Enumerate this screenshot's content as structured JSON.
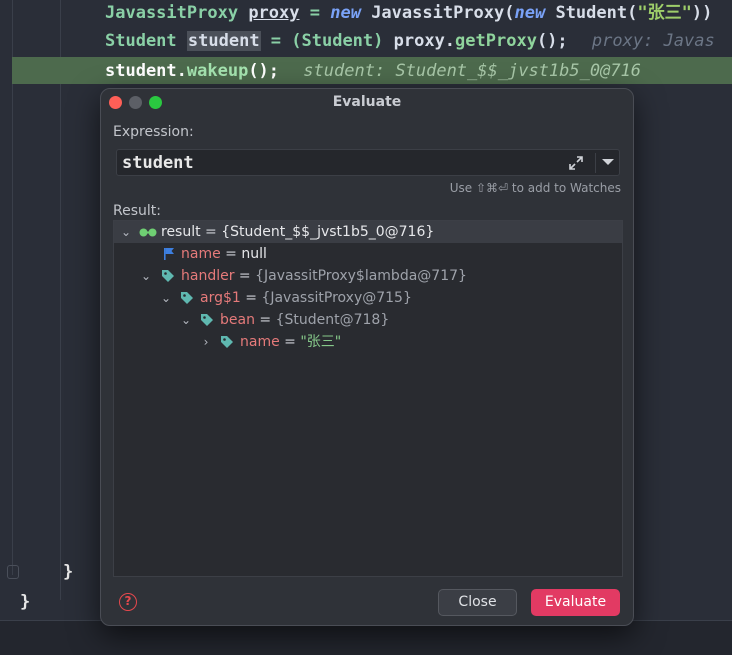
{
  "editor": {
    "line1": {
      "type": "JavassitProxy",
      "var": "proxy",
      "op": " = ",
      "kw_new": "new",
      "ctor": "JavassitProxy(",
      "kw_new2": "new",
      "arg": "Student(",
      "str": "\"张三\"",
      "tail": "))"
    },
    "line2": {
      "type": "Student",
      "var": "student",
      "op": " = (Student) ",
      "obj": "proxy.",
      "method": "getProxy",
      "tail": "();",
      "hint": "proxy: Javas"
    },
    "line3": {
      "obj": "student.",
      "method": "wakeup",
      "tail": "();",
      "hint": "student: Student_$$_jvst1b5_0@716"
    },
    "brace_inner": "}",
    "brace_outer": "}"
  },
  "dialog": {
    "title": "Evaluate",
    "expression_label": "Expression:",
    "expression_value": "student",
    "watch_hint": "Use ⇧⌘⏎ to add to Watches",
    "result_label": "Result:",
    "tree": [
      {
        "name": "result",
        "value": "{Student_$$_jvst1b5_0@716}"
      },
      {
        "name": "name",
        "value": "null"
      },
      {
        "name": "handler",
        "value": "{JavassitProxy$lambda@717}"
      },
      {
        "name": "arg$1",
        "value": "{JavassitProxy@715}"
      },
      {
        "name": "bean",
        "value": "{Student@718}"
      },
      {
        "name": "name",
        "value": "\"张三\""
      }
    ],
    "eq": " = ",
    "close_label": "Close",
    "evaluate_label": "Evaluate",
    "help_glyph": "?"
  },
  "icons": {
    "expand": "expand-icon",
    "dropdown": "chevron-down-icon",
    "watch": "glasses-icon",
    "field": "flag-icon",
    "tag": "tag-icon"
  },
  "colors": {
    "accent": "#e23a63",
    "tag": "#5fb8b0",
    "flag": "#3d7fe0"
  }
}
